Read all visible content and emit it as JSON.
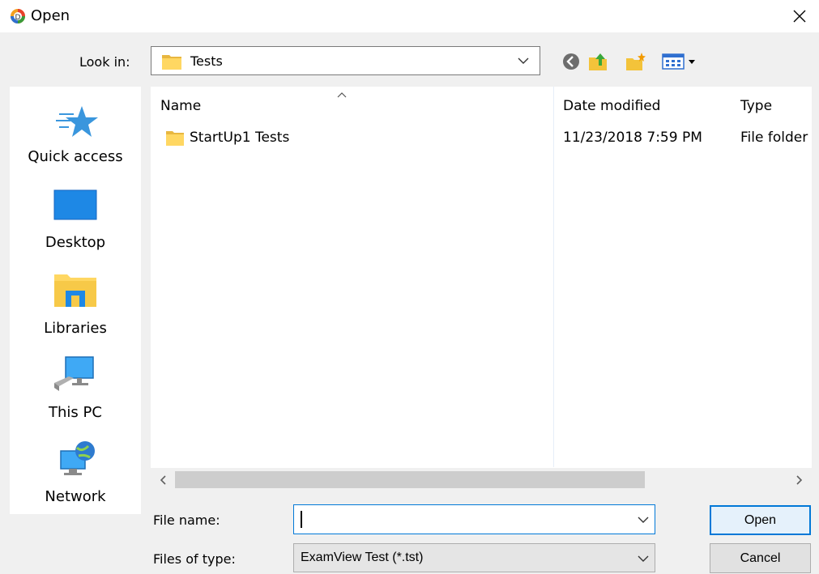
{
  "window": {
    "title": "Open"
  },
  "look_in": {
    "label": "Look in:",
    "value": "Tests"
  },
  "places": [
    {
      "label": "Quick access",
      "icon": "star-icon"
    },
    {
      "label": "Desktop",
      "icon": "desktop-icon"
    },
    {
      "label": "Libraries",
      "icon": "libraries-icon"
    },
    {
      "label": "This PC",
      "icon": "computer-icon"
    },
    {
      "label": "Network",
      "icon": "network-icon"
    }
  ],
  "columns": {
    "name": "Name",
    "date": "Date modified",
    "type": "Type"
  },
  "rows": [
    {
      "name": "StartUp1 Tests",
      "date": "11/23/2018 7:59 PM",
      "type": "File folder"
    }
  ],
  "file_name": {
    "label": "File name:",
    "value": ""
  },
  "file_type": {
    "label": "Files of type:",
    "value": "ExamView Test (*.tst)"
  },
  "buttons": {
    "open": "Open",
    "cancel": "Cancel"
  },
  "colors": {
    "accent": "#0078d7",
    "folder": "#ffd762",
    "star": "#3a96dd"
  }
}
